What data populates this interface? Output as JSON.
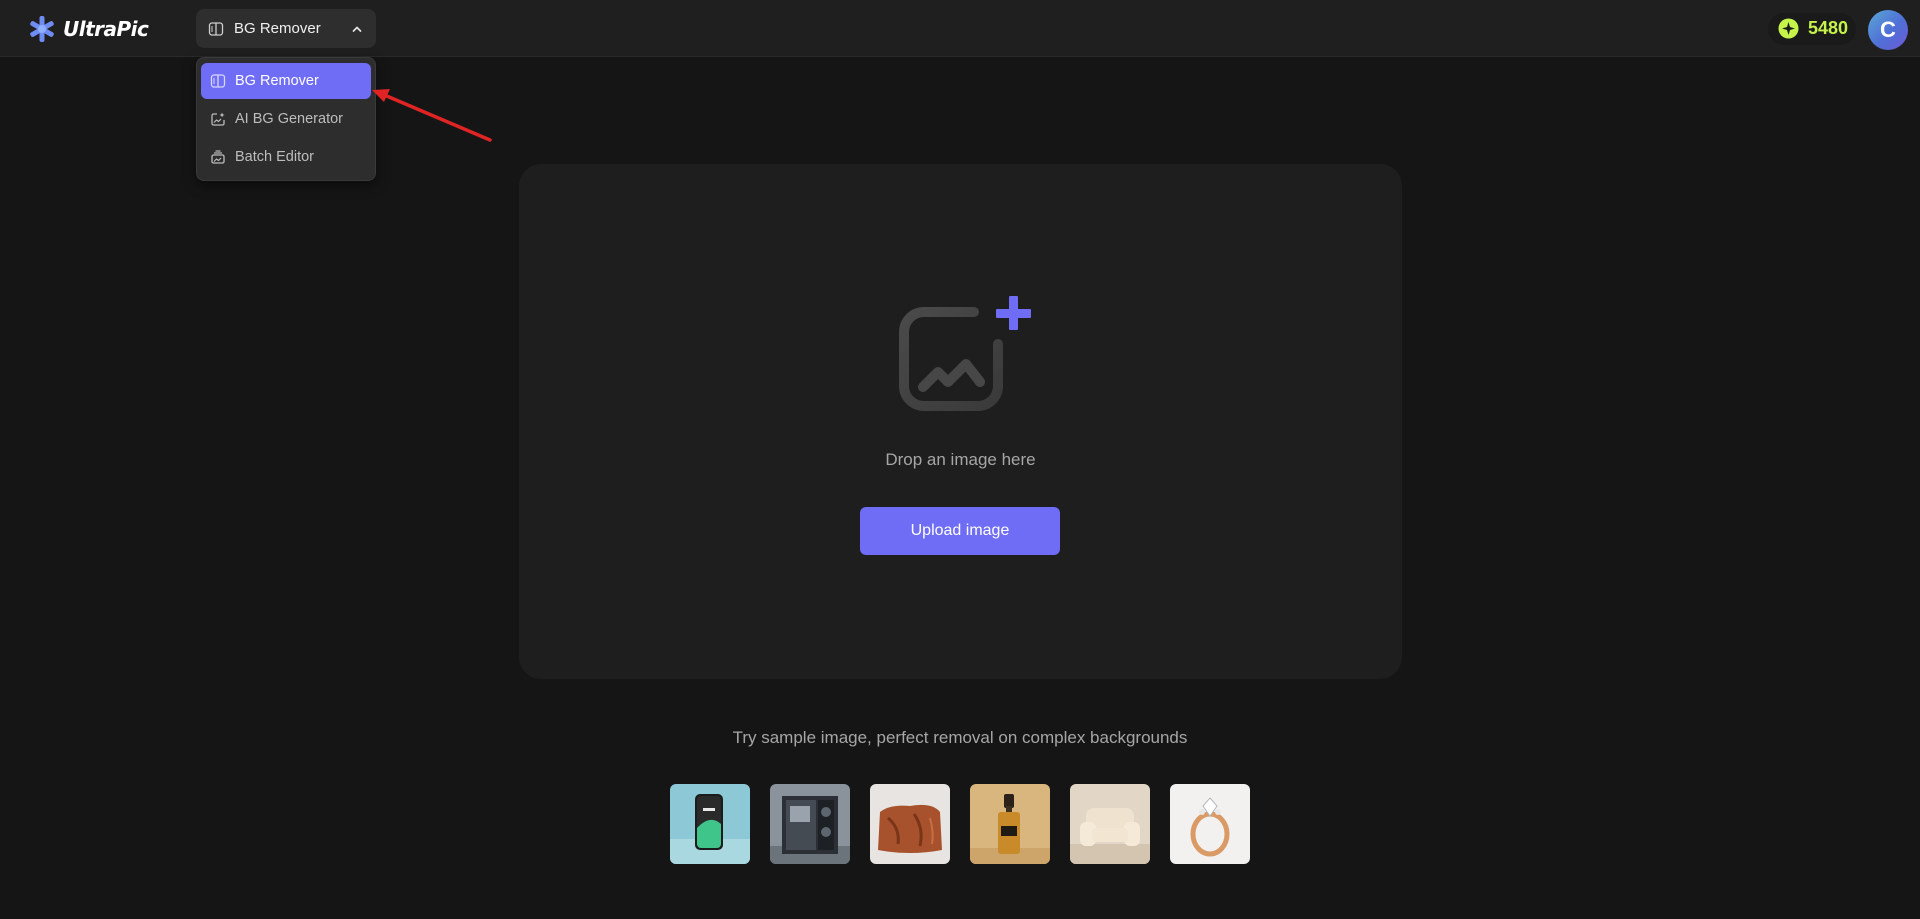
{
  "app": {
    "name": "UltraPic"
  },
  "header": {
    "tool_select": {
      "label": "BG Remover"
    },
    "credits": {
      "value": "5480"
    },
    "avatar": {
      "initial": "C"
    }
  },
  "tool_menu": {
    "items": [
      {
        "label": "BG Remover",
        "icon": "bg-remover-icon",
        "active": true
      },
      {
        "label": "AI BG Generator",
        "icon": "ai-bg-generator-icon",
        "active": false
      },
      {
        "label": "Batch Editor",
        "icon": "batch-editor-icon",
        "active": false
      }
    ]
  },
  "dropzone": {
    "text": "Drop an image here",
    "upload_label": "Upload image"
  },
  "samples": {
    "caption": "Try sample image, perfect removal on complex backgrounds",
    "items": [
      {
        "name": "smartphone"
      },
      {
        "name": "pc-case"
      },
      {
        "name": "leather-bag"
      },
      {
        "name": "serum-bottle"
      },
      {
        "name": "armchair"
      },
      {
        "name": "diamond-ring"
      }
    ]
  },
  "colors": {
    "accent": "#6f6cf5",
    "credits": "#c6f34a",
    "background": "#151515"
  }
}
